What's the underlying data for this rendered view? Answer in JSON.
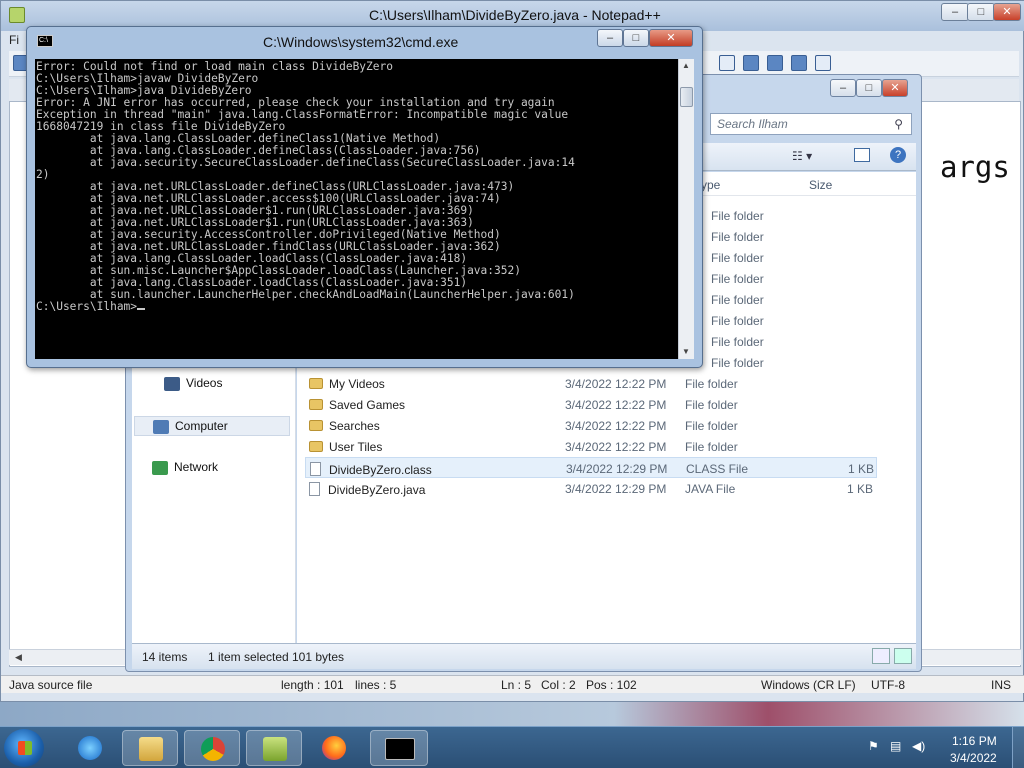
{
  "notepadpp": {
    "title": "C:\\Users\\Ilham\\DivideByZero.java - Notepad++",
    "menu_first": "Fi",
    "code_visible": "args",
    "status": {
      "type": "Java source file",
      "length": "length : 101",
      "lines": "lines : 5",
      "ln": "Ln : 5",
      "col": "Col : 2",
      "pos": "Pos : 102",
      "eol": "Windows (CR LF)",
      "encoding": "UTF-8",
      "mode": "INS"
    }
  },
  "explorer": {
    "search_placeholder": "Search Ilham",
    "column_headers": {
      "type": "ype",
      "size": "Size"
    },
    "nav": [
      {
        "label": "Videos"
      },
      {
        "label": "Computer"
      },
      {
        "label": "Network"
      }
    ],
    "hidden_rows_type": [
      "File folder",
      "File folder",
      "File folder",
      "File folder",
      "File folder",
      "File folder",
      "File folder",
      "File folder"
    ],
    "files": [
      {
        "name": "My Videos",
        "date": "3/4/2022 12:22 PM",
        "type": "File folder",
        "size": ""
      },
      {
        "name": "Saved Games",
        "date": "3/4/2022 12:22 PM",
        "type": "File folder",
        "size": ""
      },
      {
        "name": "Searches",
        "date": "3/4/2022 12:22 PM",
        "type": "File folder",
        "size": ""
      },
      {
        "name": "User Tiles",
        "date": "3/4/2022 12:22 PM",
        "type": "File folder",
        "size": ""
      },
      {
        "name": "DivideByZero.class",
        "date": "3/4/2022 12:29 PM",
        "type": "CLASS File",
        "size": "1 KB"
      },
      {
        "name": "DivideByZero.java",
        "date": "3/4/2022 12:29 PM",
        "type": "JAVA File",
        "size": "1 KB"
      }
    ],
    "status": {
      "items": "14 items",
      "selected": "1 item selected",
      "bytes": "101 bytes"
    }
  },
  "cmd": {
    "title": "C:\\Windows\\system32\\cmd.exe",
    "lines": [
      "Error: Could not find or load main class DivideByZero",
      "",
      "C:\\Users\\Ilham>javaw DivideByZero",
      "",
      "C:\\Users\\Ilham>java DivideByZero",
      "Error: A JNI error has occurred, please check your installation and try again",
      "Exception in thread \"main\" java.lang.ClassFormatError: Incompatible magic value",
      "1668047219 in class file DivideByZero",
      "        at java.lang.ClassLoader.defineClass1(Native Method)",
      "        at java.lang.ClassLoader.defineClass(ClassLoader.java:756)",
      "        at java.security.SecureClassLoader.defineClass(SecureClassLoader.java:14",
      "2)",
      "        at java.net.URLClassLoader.defineClass(URLClassLoader.java:473)",
      "        at java.net.URLClassLoader.access$100(URLClassLoader.java:74)",
      "        at java.net.URLClassLoader$1.run(URLClassLoader.java:369)",
      "        at java.net.URLClassLoader$1.run(URLClassLoader.java:363)",
      "        at java.security.AccessController.doPrivileged(Native Method)",
      "        at java.net.URLClassLoader.findClass(URLClassLoader.java:362)",
      "        at java.lang.ClassLoader.loadClass(ClassLoader.java:418)",
      "        at sun.misc.Launcher$AppClassLoader.loadClass(Launcher.java:352)",
      "        at java.lang.ClassLoader.loadClass(ClassLoader.java:351)",
      "        at sun.launcher.LauncherHelper.checkAndLoadMain(LauncherHelper.java:601)",
      "",
      "C:\\Users\\Ilham>"
    ]
  },
  "taskbar": {
    "apps": [
      {
        "icon": "internet-explorer-icon"
      },
      {
        "icon": "file-explorer-icon"
      },
      {
        "icon": "chrome-icon"
      },
      {
        "icon": "notepadpp-icon"
      },
      {
        "icon": "firefox-icon"
      },
      {
        "icon": "cmd-icon"
      }
    ],
    "clock": {
      "time": "1:16 PM",
      "date": "3/4/2022"
    }
  }
}
